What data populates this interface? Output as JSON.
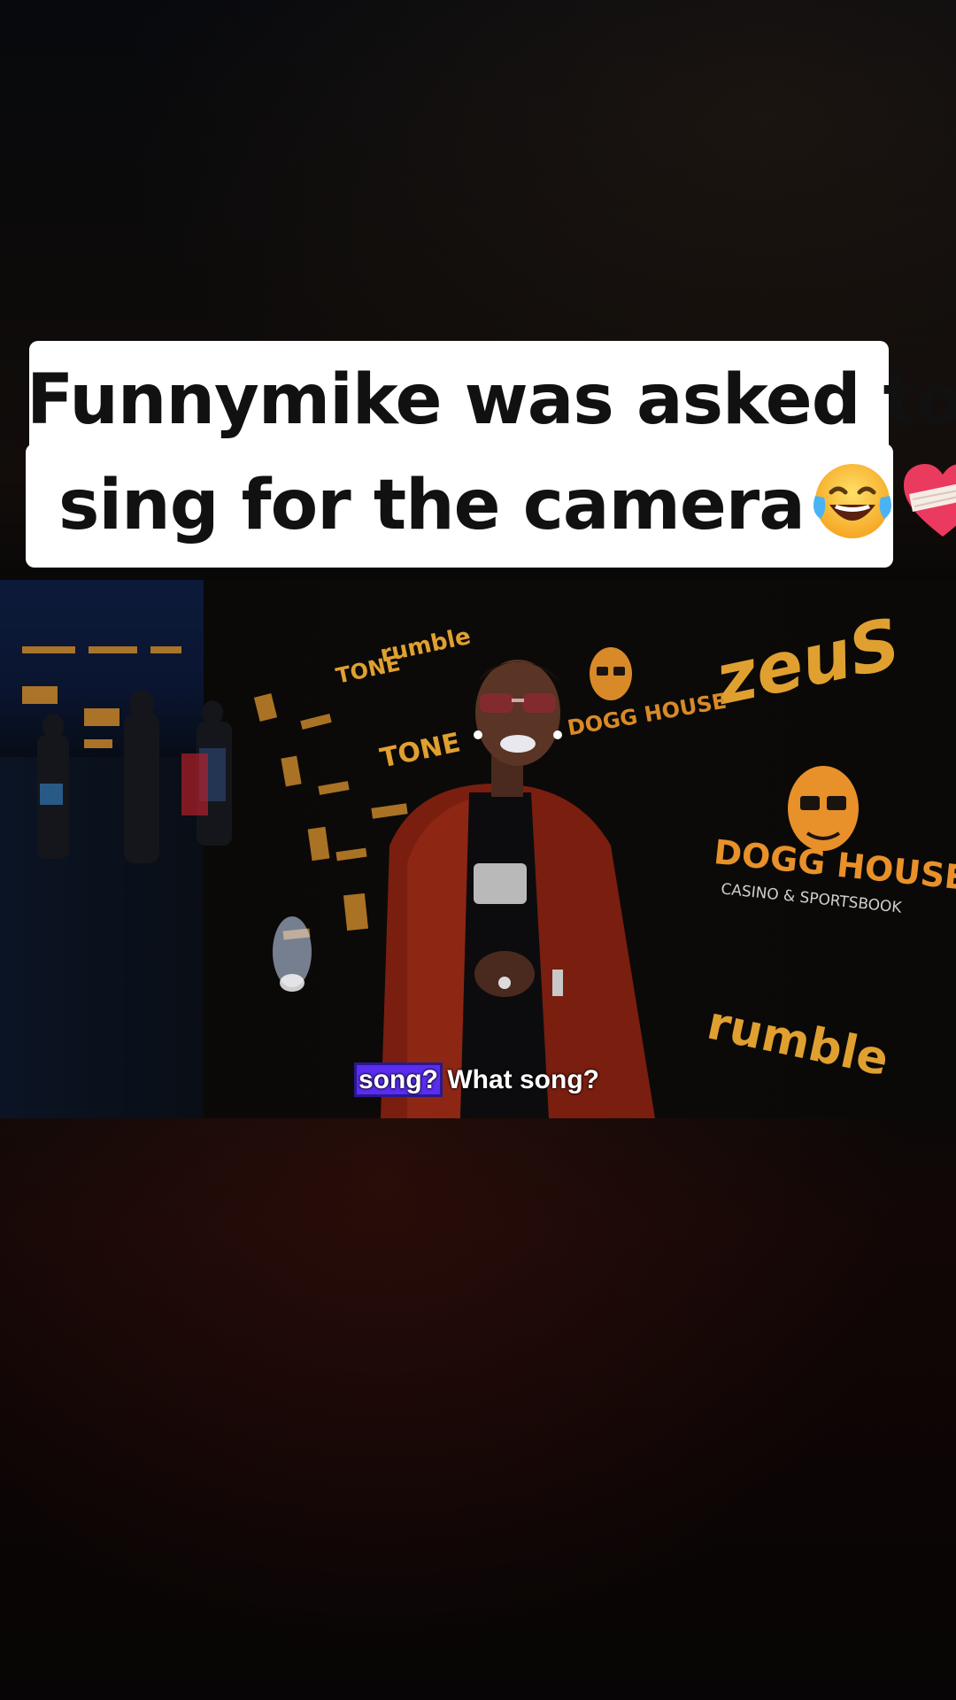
{
  "caption": {
    "line1": "Funnymike was asked to",
    "line2": "sing for the camera",
    "emojis": [
      "face-with-tears-of-joy",
      "mending-heart"
    ]
  },
  "video": {
    "subtitle_highlight": "song?",
    "subtitle_rest": " What song?",
    "backdrop_logos": {
      "zeus": "zeuS",
      "dogg_house": "DOGG HOUSE",
      "dogg_house_sub": "CASINO & SPORTSBOOK",
      "rumble": "rumble",
      "tone": "TONE"
    }
  },
  "colors": {
    "caption_bg": "#ffffff",
    "caption_text": "#111111",
    "subtitle_highlight": "#5a2df0",
    "logo_gold": "#e0a030"
  }
}
